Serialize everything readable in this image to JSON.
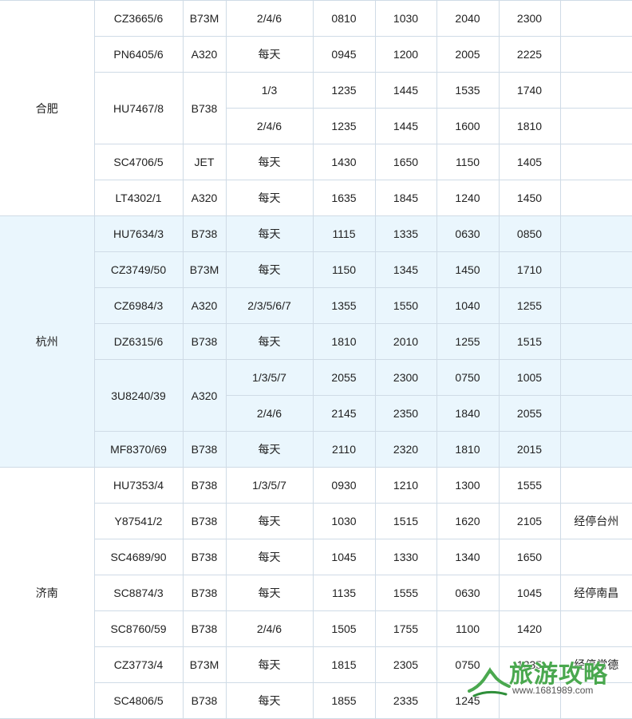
{
  "groups": [
    {
      "city": "合肥",
      "theme": "white",
      "rows": [
        {
          "flight": "CZ3665/6",
          "aircraft": "B73M",
          "days": "2/4/6",
          "dep1": "0810",
          "arr1": "1030",
          "dep2": "2040",
          "arr2": "2300",
          "note": ""
        },
        {
          "flight": "PN6405/6",
          "aircraft": "A320",
          "days": "每天",
          "dep1": "0945",
          "arr1": "1200",
          "dep2": "2005",
          "arr2": "2225",
          "note": ""
        },
        {
          "flight": "HU7467/8",
          "aircraft": "B738",
          "days": "1/3",
          "dep1": "1235",
          "arr1": "1445",
          "dep2": "1535",
          "arr2": "1740",
          "note": "",
          "span2": true
        },
        {
          "days": "2/4/6",
          "dep1": "1235",
          "arr1": "1445",
          "dep2": "1600",
          "arr2": "1810",
          "note": ""
        },
        {
          "flight": "SC4706/5",
          "aircraft": "JET",
          "days": "每天",
          "dep1": "1430",
          "arr1": "1650",
          "dep2": "1150",
          "arr2": "1405",
          "note": ""
        },
        {
          "flight": "LT4302/1",
          "aircraft": "A320",
          "days": "每天",
          "dep1": "1635",
          "arr1": "1845",
          "dep2": "1240",
          "arr2": "1450",
          "note": ""
        }
      ]
    },
    {
      "city": "杭州",
      "theme": "blue",
      "rows": [
        {
          "flight": "HU7634/3",
          "aircraft": "B738",
          "days": "每天",
          "dep1": "1115",
          "arr1": "1335",
          "dep2": "0630",
          "arr2": "0850",
          "note": ""
        },
        {
          "flight": "CZ3749/50",
          "aircraft": "B73M",
          "days": "每天",
          "dep1": "1150",
          "arr1": "1345",
          "dep2": "1450",
          "arr2": "1710",
          "note": ""
        },
        {
          "flight": "CZ6984/3",
          "aircraft": "A320",
          "days": "2/3/5/6/7",
          "dep1": "1355",
          "arr1": "1550",
          "dep2": "1040",
          "arr2": "1255",
          "note": ""
        },
        {
          "flight": "DZ6315/6",
          "aircraft": "B738",
          "days": "每天",
          "dep1": "1810",
          "arr1": "2010",
          "dep2": "1255",
          "arr2": "1515",
          "note": ""
        },
        {
          "flight": "3U8240/39",
          "aircraft": "A320",
          "days": "1/3/5/7",
          "dep1": "2055",
          "arr1": "2300",
          "dep2": "0750",
          "arr2": "1005",
          "note": "",
          "span2": true
        },
        {
          "days": "2/4/6",
          "dep1": "2145",
          "arr1": "2350",
          "dep2": "1840",
          "arr2": "2055",
          "note": ""
        },
        {
          "flight": "MF8370/69",
          "aircraft": "B738",
          "days": "每天",
          "dep1": "2110",
          "arr1": "2320",
          "dep2": "1810",
          "arr2": "2015",
          "note": ""
        }
      ]
    },
    {
      "city": "济南",
      "theme": "white",
      "rows": [
        {
          "flight": "HU7353/4",
          "aircraft": "B738",
          "days": "1/3/5/7",
          "dep1": "0930",
          "arr1": "1210",
          "dep2": "1300",
          "arr2": "1555",
          "note": ""
        },
        {
          "flight": "Y87541/2",
          "aircraft": "B738",
          "days": "每天",
          "dep1": "1030",
          "arr1": "1515",
          "dep2": "1620",
          "arr2": "2105",
          "note": "经停台州"
        },
        {
          "flight": "SC4689/90",
          "aircraft": "B738",
          "days": "每天",
          "dep1": "1045",
          "arr1": "1330",
          "dep2": "1340",
          "arr2": "1650",
          "note": ""
        },
        {
          "flight": "SC8874/3",
          "aircraft": "B738",
          "days": "每天",
          "dep1": "1135",
          "arr1": "1555",
          "dep2": "0630",
          "arr2": "1045",
          "note": "经停南昌"
        },
        {
          "flight": "SC8760/59",
          "aircraft": "B738",
          "days": "2/4/6",
          "dep1": "1505",
          "arr1": "1755",
          "dep2": "1100",
          "arr2": "1420",
          "note": ""
        },
        {
          "flight": "CZ3773/4",
          "aircraft": "B73M",
          "days": "每天",
          "dep1": "1815",
          "arr1": "2305",
          "dep2": "0750",
          "arr2": "1235",
          "note": "经停常德"
        },
        {
          "flight": "SC4806/5",
          "aircraft": "B738",
          "days": "每天",
          "dep1": "1855",
          "arr1": "2335",
          "dep2": "1245",
          "arr2": "",
          "note": ""
        }
      ]
    }
  ],
  "watermark": {
    "brand": "旅游攻略",
    "url": "www.1681989.com",
    "brand_color": "#4aa84f"
  }
}
